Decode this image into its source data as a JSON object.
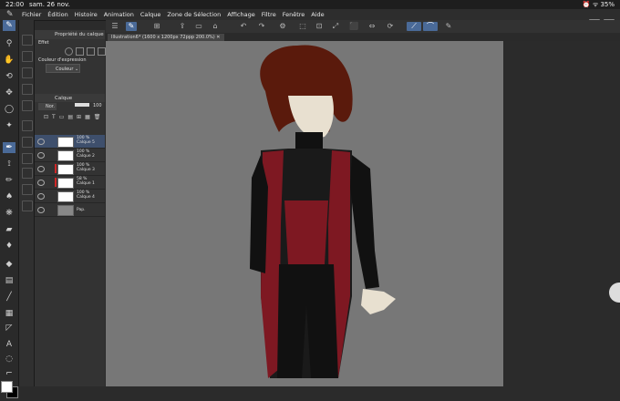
{
  "status": {
    "time": "22:00",
    "date": "sam. 26 nov.",
    "battery": "35%"
  },
  "menu": [
    "Fichier",
    "Édition",
    "Histoire",
    "Animation",
    "Calque",
    "Zone de Sélection",
    "Affichage",
    "Filtre",
    "Fenêtre",
    "Aide"
  ],
  "document_tab": "Illustration6* (1600 x 1200px 72ppp 200.0%)",
  "panels": {
    "property_title": "Propriété du calque",
    "effect_label": "Effet",
    "expression_label": "Couleur d'expression",
    "expression_value": "Couleur",
    "layer_title": "Calque",
    "blend_mode": "Nor.",
    "opacity": "100"
  },
  "layers": [
    {
      "opacity": "100 %",
      "name": "Calque 5",
      "selected": true
    },
    {
      "opacity": "100 %",
      "name": "Calque 2",
      "selected": false
    },
    {
      "opacity": "100 %",
      "name": "Calque 3",
      "selected": false
    },
    {
      "opacity": "58 %",
      "name": "Calque 1",
      "selected": false
    },
    {
      "opacity": "100 %",
      "name": "Calque 4",
      "selected": false
    },
    {
      "opacity": "",
      "name": "Pap.",
      "selected": false
    }
  ],
  "icons": {
    "tools": [
      "brush-icon",
      "search-icon",
      "hand-icon",
      "rotate-icon",
      "move-icon",
      "lasso-icon",
      "wand-icon",
      "eyedropper-icon",
      "pen-icon",
      "pencil-icon",
      "brush2-icon",
      "airbrush-icon",
      "decoration-icon",
      "eraser-icon",
      "blend-icon",
      "fill-icon",
      "gradient-icon",
      "figure-icon",
      "frame-icon",
      "ruler-icon",
      "text-icon",
      "balloon-icon",
      "correct-icon"
    ]
  },
  "colors": {
    "accent": "#4a6a98",
    "layer_red": "#d02828"
  }
}
